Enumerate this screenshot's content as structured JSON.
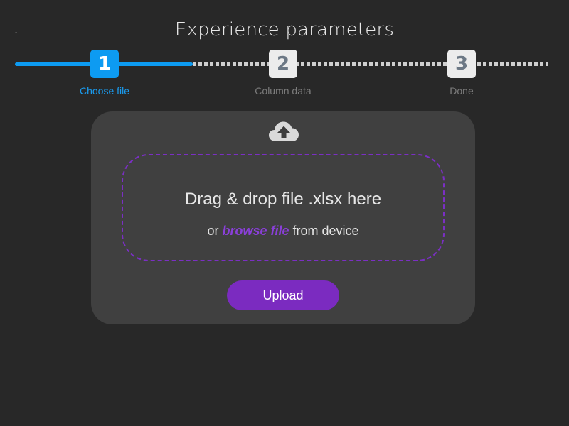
{
  "header": {
    "tiny_mark": "-",
    "title": "Experience parameters"
  },
  "stepper": {
    "steps": [
      {
        "number": "1",
        "label": "Choose file",
        "state": "active"
      },
      {
        "number": "2",
        "label": "Column data",
        "state": "pending"
      },
      {
        "number": "3",
        "label": "Done",
        "state": "pending"
      }
    ],
    "active_color": "#0d9bf2"
  },
  "upload": {
    "icon": "cloud-upload-icon",
    "drop_title": "Drag & drop file .xlsx here",
    "sub_prefix": "or",
    "browse_label": "browse file",
    "sub_suffix": "from device",
    "button_label": "Upload",
    "accent_color": "#7b2bc0"
  }
}
